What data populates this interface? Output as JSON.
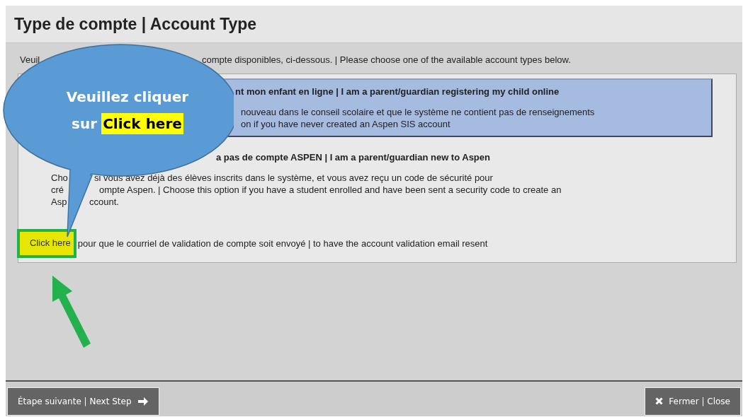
{
  "dialog": {
    "title": "Type de compte | Account Type"
  },
  "instruction": {
    "left": "Veuil",
    "right": "compte disponibles, ci-dessous. | Please choose one of the available account types below."
  },
  "options": [
    {
      "selected": true,
      "title": {
        "right": "nt mon enfant en ligne | I am a parent/guardian registering my child online"
      },
      "description": [
        {
          "right": "nouveau dans le conseil scolaire et que le système ne contient pas de renseignements"
        },
        {
          "right": "on if you have never created an Aspen SIS account"
        }
      ]
    },
    {
      "selected": false,
      "title": {
        "right": "a pas de compte ASPEN | I am a parent/guardian new to Aspen"
      },
      "description": [
        {
          "left": "Cho",
          "right": "si vous avez déjà des élèves inscrits dans le système, et vous avez reçu un code de sécurité pour"
        },
        {
          "left": "cré",
          "right": "ompte Aspen. | Choose this option if you have a student enrolled and have been sent a security code to create an"
        },
        {
          "left": "Asp",
          "right": "ccount."
        }
      ]
    }
  ],
  "resend": {
    "link": "Click here",
    "text": "pour que le courriel de validation de compte soit envoyé | to have the account validation email resent"
  },
  "callout": {
    "line1": "Veuillez cliquer",
    "prefix": "sur",
    "highlight": "Click here"
  },
  "buttons": {
    "next": "Étape suivante | Next Step",
    "close": "Fermer | Close"
  }
}
